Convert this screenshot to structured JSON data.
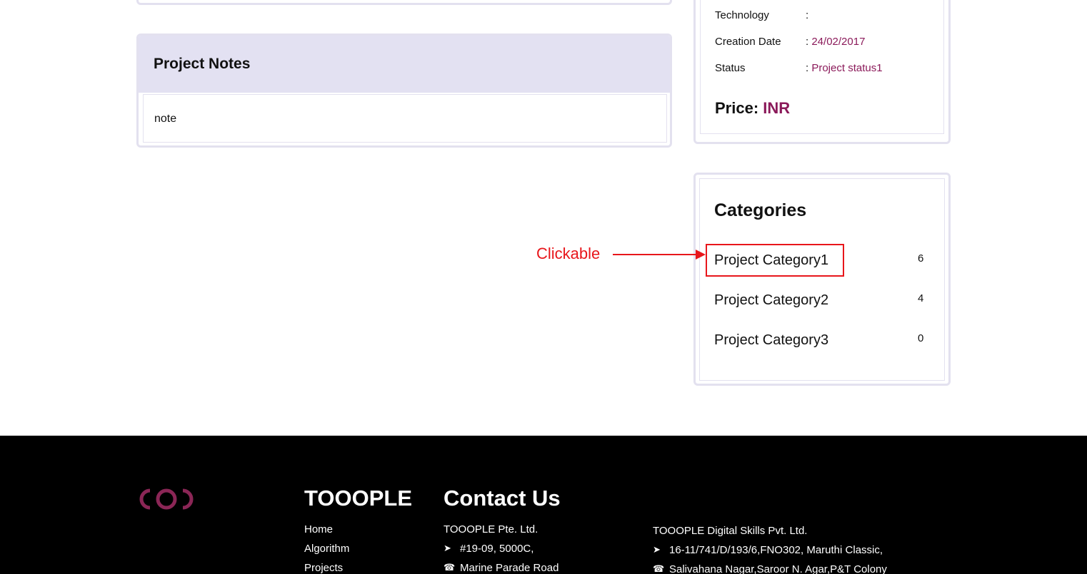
{
  "project_notes": {
    "title": "Project Notes",
    "note": "note"
  },
  "details": {
    "technology": {
      "label": "Technology",
      "value": ""
    },
    "creation_date": {
      "label": "Creation Date",
      "value": "24/02/2017"
    },
    "status": {
      "label": "Status",
      "value": "Project status1"
    },
    "price_label": "Price:",
    "price_currency": "INR",
    "value_color": "#8b1a5a"
  },
  "categories": {
    "title": "Categories",
    "items": [
      {
        "label": "Project Category1",
        "count": "6"
      },
      {
        "label": "Project Category2",
        "count": "4"
      },
      {
        "label": "Project Category3",
        "count": "0"
      }
    ]
  },
  "annotation": {
    "label": "Clickable",
    "color": "#e8161b"
  },
  "footer": {
    "brand": "TOOOPLE",
    "links": [
      "Home",
      "Algorithm",
      "Projects"
    ],
    "contact_title": "Contact Us",
    "office_sg": {
      "name": "TOOOPLE Pte. Ltd.",
      "address_line": "#19-09, 5000C,",
      "phone_line": "Marine Parade Road"
    },
    "office_in": {
      "name": "TOOOPLE Digital Skills Pvt. Ltd.",
      "address_line": "16-11/741/D/193/6,FNO302, Maruthi Classic,",
      "phone_line": "Salivahana Nagar,Saroor N. Agar,P&T Colony"
    },
    "icons": [
      "logo-icon",
      "location-arrow-icon",
      "phone-icon"
    ]
  }
}
